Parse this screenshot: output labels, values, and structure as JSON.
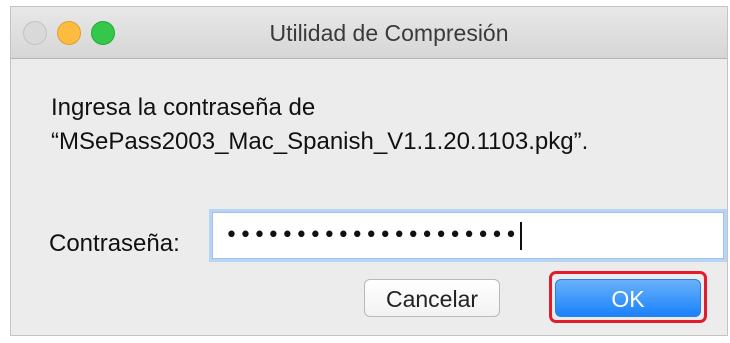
{
  "window": {
    "title": "Utilidad de Compresión"
  },
  "message": {
    "line1": "Ingresa la contraseña de",
    "line2": "“MSePass2003_Mac_Spanish_V1.1.20.1103.pkg”."
  },
  "password": {
    "label": "Contraseña:",
    "masked_value": "•••••••••••••••••••••"
  },
  "buttons": {
    "cancel_label": "Cancelar",
    "ok_label": "OK"
  },
  "colors": {
    "highlight": "#e01c2d",
    "ok_button": "#1a82fb"
  }
}
